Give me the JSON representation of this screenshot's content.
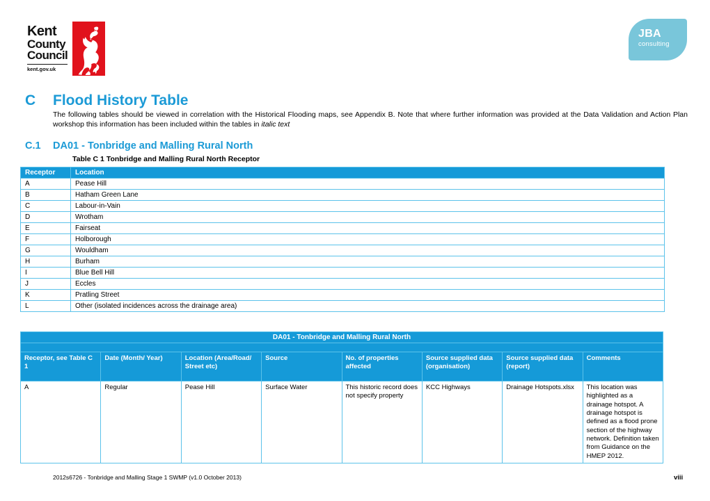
{
  "logos": {
    "kcc": {
      "line1": "Kent",
      "line2": "County",
      "line3": "Council",
      "url": "kent.gov.uk",
      "red_hex": "#e1121c"
    },
    "jba": {
      "name": "JBA",
      "subtitle": "consulting",
      "teal_hex": "#79c6da"
    }
  },
  "headings": {
    "appendix_letter": "C",
    "appendix_title": "Flood History Table",
    "accent_hex": "#1b9ad6",
    "intro_part1": "The following tables should be viewed in correlation with the Historical Flooding maps, see Appendix B.  Note that where further information was provided at the Data Validation and Action Plan workshop this information has been included within the tables in ",
    "intro_italic": "italic text",
    "section_number": "C.1",
    "section_title": "DA01 - Tonbridge and Malling Rural North"
  },
  "table1": {
    "caption": "Table C 1 Tonbridge and Malling Rural North Receptor",
    "header_hex": "#159ad8",
    "columns": [
      "Receptor",
      "Location"
    ],
    "rows": [
      [
        "A",
        "Pease Hill"
      ],
      [
        "B",
        "Hatham Green Lane"
      ],
      [
        "C",
        "Labour-in-Vain"
      ],
      [
        "D",
        "Wrotham"
      ],
      [
        "E",
        "Fairseat"
      ],
      [
        "F",
        "Holborough"
      ],
      [
        "G",
        "Wouldham"
      ],
      [
        "H",
        "Burham"
      ],
      [
        "I",
        "Blue Bell Hill"
      ],
      [
        "J",
        "Eccles"
      ],
      [
        "K",
        "Pratling Street"
      ],
      [
        "L",
        "Other (isolated incidences across the drainage area)"
      ]
    ]
  },
  "table2": {
    "title": "DA01 - Tonbridge and Malling Rural North",
    "header_hex": "#159ad8",
    "columns": [
      "Receptor, see Table C 1",
      "Date (Month/ Year)",
      "Location (Area/Road/ Street etc)",
      "Source",
      "No. of properties affected",
      "Source supplied data (organisation)",
      "Source supplied data (report)",
      "Comments"
    ],
    "rows": [
      {
        "receptor": "A",
        "date": "Regular",
        "location": "Pease Hill",
        "source": "Surface Water",
        "properties": "This historic record does not specify property",
        "org": "KCC Highways",
        "report": "Drainage Hotspots.xlsx",
        "comments": "This location was highlighted as a drainage hotspot.  A drainage hotspot is defined as a flood prone section of the highway network.  Definition taken from Guidance on the HMEP 2012."
      }
    ]
  },
  "footer": {
    "reference": "2012s6726 - Tonbridge and Malling  Stage 1 SWMP (v1.0 October 2013)",
    "page": "viii"
  }
}
